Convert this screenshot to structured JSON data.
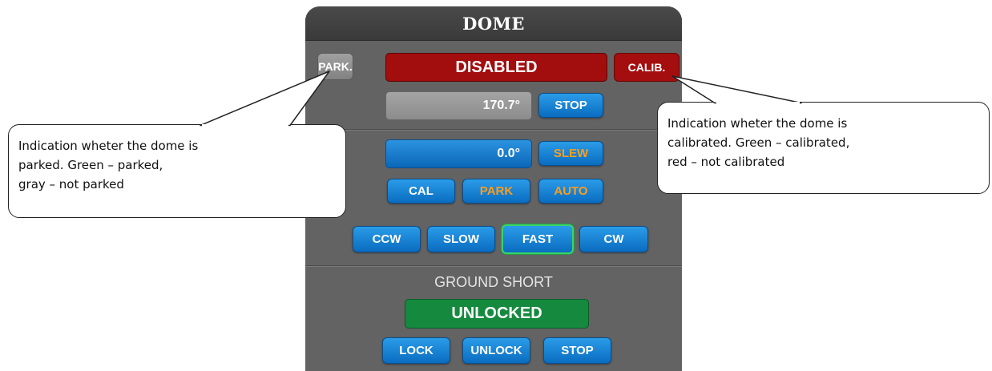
{
  "panel": {
    "title": "DOME",
    "park_indicator": "PARK.",
    "status": "DISABLED",
    "calib_indicator": "CALIB.",
    "position_readout": "170.7°",
    "stop_label": "STOP",
    "target_value": "0.0°",
    "slew_label": "SLEW",
    "cal_label": "CAL",
    "park_label": "PARK",
    "auto_label": "AUTO",
    "ccw_label": "CCW",
    "slow_label": "SLOW",
    "fast_label": "FAST",
    "cw_label": "CW",
    "ground_short_label": "GROUND SHORT",
    "lock_status": "UNLOCKED",
    "lock_label": "LOCK",
    "unlock_label": "UNLOCK",
    "stop2_label": "STOP"
  },
  "callouts": {
    "park": [
      "Indication wheter the dome is",
      "parked. Green – parked,",
      "gray – not parked"
    ],
    "calib": [
      "Indication wheter the dome is",
      "calibrated. Green – calibrated,",
      "red – not calibrated"
    ]
  },
  "colors": {
    "panel_bg": "#636363",
    "button_blue": "#1a85d6",
    "accent_orange": "#ff9d1c",
    "status_red": "#a20d0d",
    "status_green": "#15893e",
    "fast_highlight": "#39d36a"
  }
}
